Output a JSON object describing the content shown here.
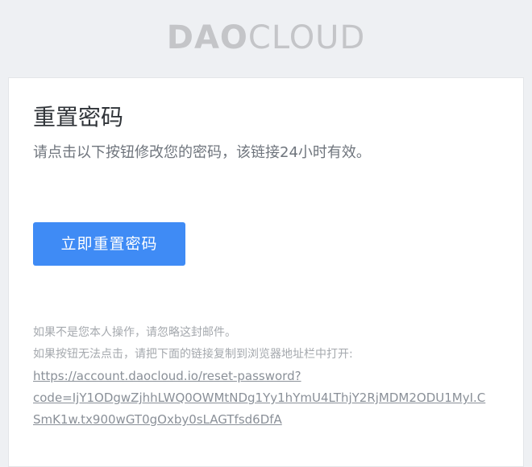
{
  "header": {
    "logo_bold": "DAO",
    "logo_light": "CLOUD"
  },
  "email": {
    "title": "重置密码",
    "subtitle": "请点击以下按钮修改您的密码，该链接24小时有效。",
    "button_label": "立即重置密码",
    "ignore_note": "如果不是您本人操作，请忽略这封邮件。",
    "fallback_note": "如果按钮无法点击，请把下面的链接复制到浏览器地址栏中打开:",
    "reset_link_line1": "https://account.daocloud.io/reset-password?",
    "reset_link_line2": "code=IjY1ODgwZjhhLWQ0OWMtNDg1Yy1hYmU4LThjY2RjMDM2ODU1MyI.C",
    "reset_link_line3": "SmK1w.tx900wGT0gOxby0sLAGTfsd6DfA"
  },
  "colors": {
    "background": "#eef0f3",
    "button": "#3f8bf5",
    "logo": "#c4c5c8"
  }
}
